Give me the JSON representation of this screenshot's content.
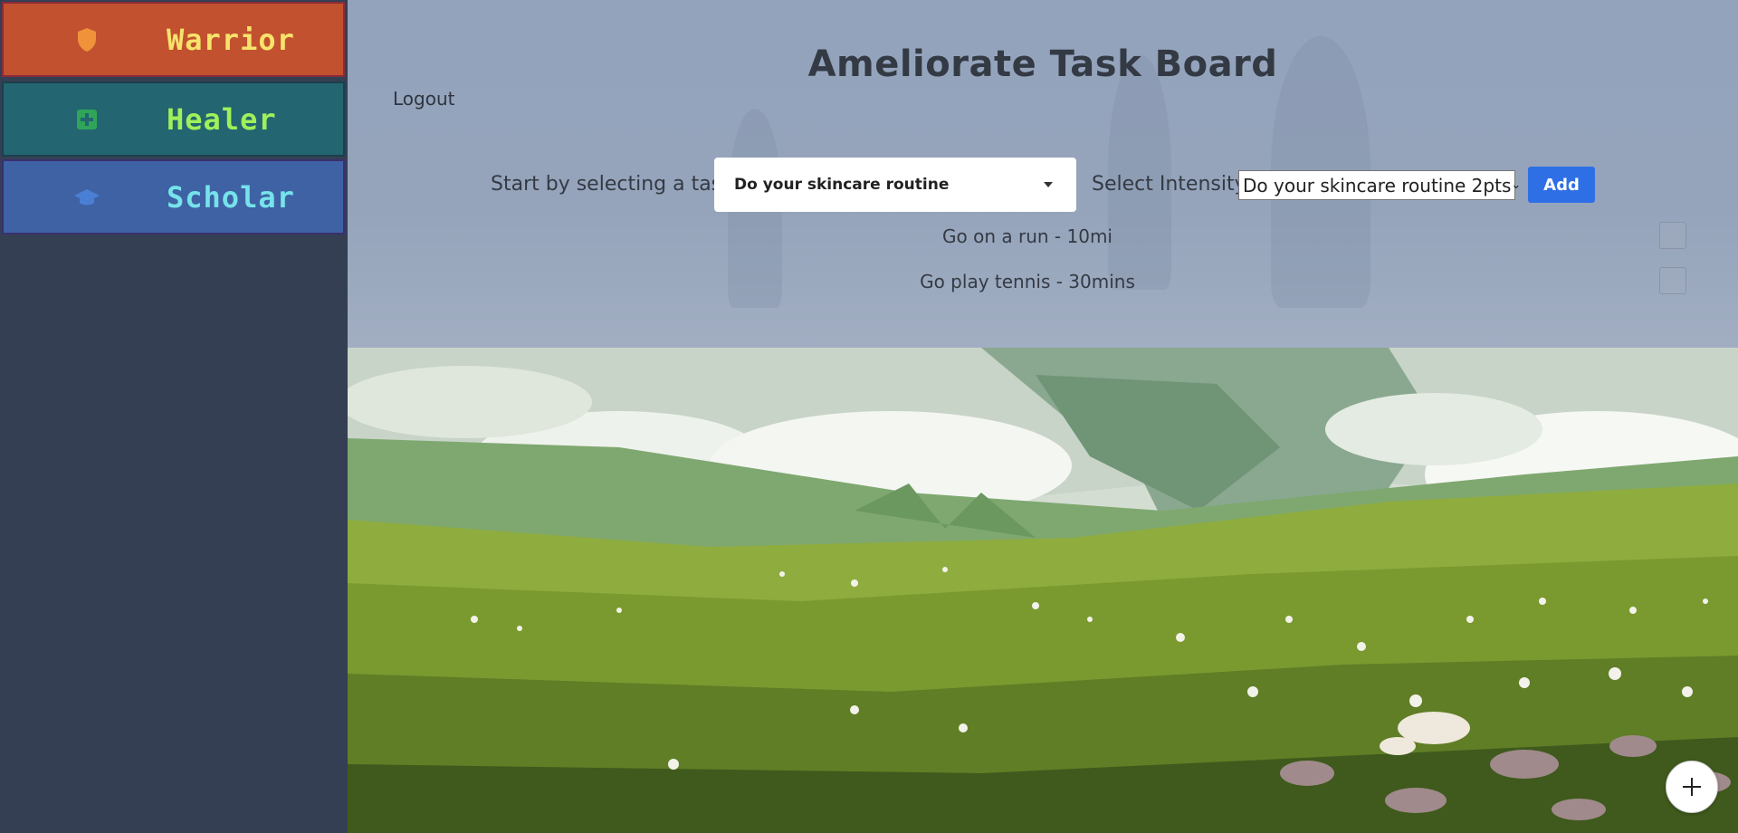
{
  "sidebar": {
    "classes": [
      {
        "label": "Warrior",
        "icon": "shield-icon",
        "color": "#c1512f"
      },
      {
        "label": "Healer",
        "icon": "medical-cross-icon",
        "color": "#236570"
      },
      {
        "label": "Scholar",
        "icon": "graduation-cap-icon",
        "color": "#3e62a3"
      }
    ]
  },
  "header": {
    "title": "Ameliorate Task Board",
    "logout_label": "Logout"
  },
  "task_form": {
    "select_label": "Start by selecting a task",
    "selected_task": "Do your skincare routine",
    "intensity_label": "Select Intensity",
    "selected_intensity": "Do your skincare routine 2pts",
    "add_label": "Add"
  },
  "tasks": [
    {
      "text": "Go on a run - 10mi",
      "checked": false
    },
    {
      "text": "Go play tennis - 30mins",
      "checked": false
    }
  ],
  "fab": {
    "icon": "plus-icon"
  },
  "colors": {
    "accent": "#2f6fe6",
    "sidebar": "#353f53",
    "header_bg": "#94a3bc"
  }
}
